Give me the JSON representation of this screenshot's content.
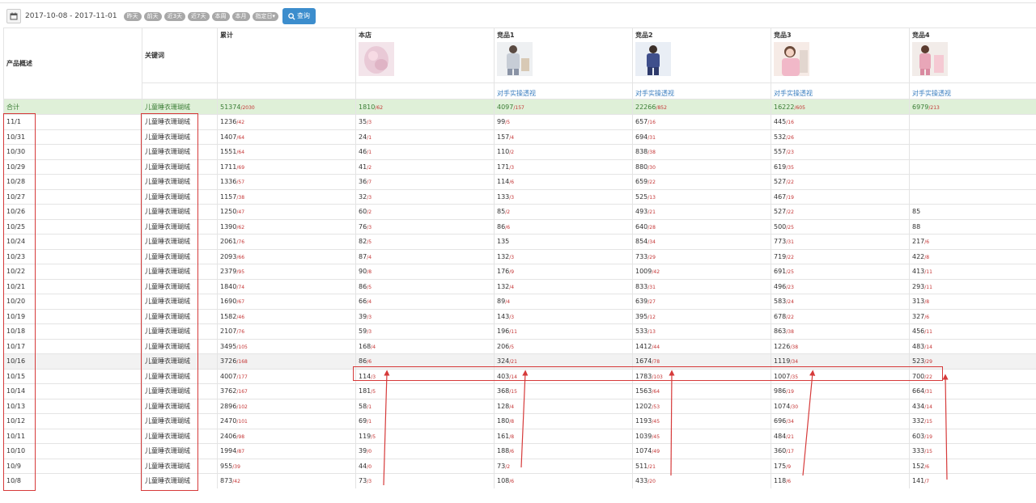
{
  "toolbar": {
    "date_range": "2017-10-08 - 2017-11-01",
    "quick_buttons": [
      "昨天",
      "前天",
      "近3天",
      "近7天",
      "本周",
      "本月",
      "指定日▾"
    ],
    "query_label": "查询"
  },
  "table": {
    "headers": {
      "overview": "产品概述",
      "keyword": "关键词",
      "cumulative": "累计",
      "store": "本店",
      "competitors": [
        "竞品1",
        "竞品2",
        "竞品3",
        "竞品4"
      ]
    },
    "competitor_link": "对手实操透视",
    "total": {
      "label": "合计",
      "keyword": "儿童睡衣珊瑚绒",
      "cells": [
        [
          "51374",
          "/2030"
        ],
        [
          "1810",
          "/62"
        ],
        [
          "4097",
          "/157"
        ],
        [
          "22266",
          "/852"
        ],
        [
          "16222",
          "/605"
        ],
        [
          "6979",
          "/213"
        ]
      ]
    },
    "rows": [
      {
        "date": "11/1",
        "keyword": "儿童睡衣珊瑚绒",
        "cells": [
          [
            "1236",
            "/42"
          ],
          [
            "35",
            "/3"
          ],
          [
            "99",
            "/5"
          ],
          [
            "657",
            "/16"
          ],
          [
            "445",
            "/16"
          ],
          [
            "",
            ""
          ]
        ]
      },
      {
        "date": "10/31",
        "keyword": "儿童睡衣珊瑚绒",
        "cells": [
          [
            "1407",
            "/64"
          ],
          [
            "24",
            "/1"
          ],
          [
            "157",
            "/4"
          ],
          [
            "694",
            "/31"
          ],
          [
            "532",
            "/26"
          ],
          [
            "",
            ""
          ]
        ]
      },
      {
        "date": "10/30",
        "keyword": "儿童睡衣珊瑚绒",
        "cells": [
          [
            "1551",
            "/64"
          ],
          [
            "46",
            "/1"
          ],
          [
            "110",
            "/2"
          ],
          [
            "838",
            "/38"
          ],
          [
            "557",
            "/23"
          ],
          [
            "",
            ""
          ]
        ]
      },
      {
        "date": "10/29",
        "keyword": "儿童睡衣珊瑚绒",
        "cells": [
          [
            "1711",
            "/69"
          ],
          [
            "41",
            "/2"
          ],
          [
            "171",
            "/3"
          ],
          [
            "880",
            "/30"
          ],
          [
            "619",
            "/35"
          ],
          [
            "",
            ""
          ]
        ]
      },
      {
        "date": "10/28",
        "keyword": "儿童睡衣珊瑚绒",
        "cells": [
          [
            "1336",
            "/57"
          ],
          [
            "36",
            "/7"
          ],
          [
            "114",
            "/6"
          ],
          [
            "659",
            "/22"
          ],
          [
            "527",
            "/22"
          ],
          [
            "",
            ""
          ]
        ]
      },
      {
        "date": "10/27",
        "keyword": "儿童睡衣珊瑚绒",
        "cells": [
          [
            "1157",
            "/38"
          ],
          [
            "32",
            "/3"
          ],
          [
            "133",
            "/3"
          ],
          [
            "525",
            "/13"
          ],
          [
            "467",
            "/19"
          ],
          [
            "",
            ""
          ]
        ]
      },
      {
        "date": "10/26",
        "keyword": "儿童睡衣珊瑚绒",
        "cells": [
          [
            "1250",
            "/47"
          ],
          [
            "60",
            "/2"
          ],
          [
            "85",
            "/2"
          ],
          [
            "493",
            "/21"
          ],
          [
            "527",
            "/22"
          ],
          [
            "85",
            ""
          ]
        ]
      },
      {
        "date": "10/25",
        "keyword": "儿童睡衣珊瑚绒",
        "cells": [
          [
            "1390",
            "/62"
          ],
          [
            "76",
            "/3"
          ],
          [
            "86",
            "/6"
          ],
          [
            "640",
            "/28"
          ],
          [
            "500",
            "/25"
          ],
          [
            "88",
            ""
          ]
        ]
      },
      {
        "date": "10/24",
        "keyword": "儿童睡衣珊瑚绒",
        "cells": [
          [
            "2061",
            "/76"
          ],
          [
            "82",
            "/5"
          ],
          [
            "135",
            ""
          ],
          [
            "854",
            "/34"
          ],
          [
            "773",
            "/31"
          ],
          [
            "217",
            "/6"
          ]
        ]
      },
      {
        "date": "10/23",
        "keyword": "儿童睡衣珊瑚绒",
        "cells": [
          [
            "2093",
            "/66"
          ],
          [
            "87",
            "/4"
          ],
          [
            "132",
            "/3"
          ],
          [
            "733",
            "/29"
          ],
          [
            "719",
            "/22"
          ],
          [
            "422",
            "/8"
          ]
        ]
      },
      {
        "date": "10/22",
        "keyword": "儿童睡衣珊瑚绒",
        "cells": [
          [
            "2379",
            "/95"
          ],
          [
            "90",
            "/8"
          ],
          [
            "176",
            "/9"
          ],
          [
            "1009",
            "/42"
          ],
          [
            "691",
            "/25"
          ],
          [
            "413",
            "/11"
          ]
        ]
      },
      {
        "date": "10/21",
        "keyword": "儿童睡衣珊瑚绒",
        "cells": [
          [
            "1840",
            "/74"
          ],
          [
            "86",
            "/5"
          ],
          [
            "132",
            "/4"
          ],
          [
            "833",
            "/31"
          ],
          [
            "496",
            "/23"
          ],
          [
            "293",
            "/11"
          ]
        ]
      },
      {
        "date": "10/20",
        "keyword": "儿童睡衣珊瑚绒",
        "cells": [
          [
            "1690",
            "/67"
          ],
          [
            "66",
            "/4"
          ],
          [
            "89",
            "/4"
          ],
          [
            "639",
            "/27"
          ],
          [
            "583",
            "/24"
          ],
          [
            "313",
            "/8"
          ]
        ]
      },
      {
        "date": "10/19",
        "keyword": "儿童睡衣珊瑚绒",
        "cells": [
          [
            "1582",
            "/46"
          ],
          [
            "39",
            "/3"
          ],
          [
            "143",
            "/3"
          ],
          [
            "395",
            "/12"
          ],
          [
            "678",
            "/22"
          ],
          [
            "327",
            "/6"
          ]
        ]
      },
      {
        "date": "10/18",
        "keyword": "儿童睡衣珊瑚绒",
        "cells": [
          [
            "2107",
            "/76"
          ],
          [
            "59",
            "/3"
          ],
          [
            "196",
            "/11"
          ],
          [
            "533",
            "/13"
          ],
          [
            "863",
            "/38"
          ],
          [
            "456",
            "/11"
          ]
        ]
      },
      {
        "date": "10/17",
        "keyword": "儿童睡衣珊瑚绒",
        "cells": [
          [
            "3495",
            "/105"
          ],
          [
            "168",
            "/4"
          ],
          [
            "206",
            "/5"
          ],
          [
            "1412",
            "/44"
          ],
          [
            "1226",
            "/38"
          ],
          [
            "483",
            "/14"
          ]
        ]
      },
      {
        "date": "10/16",
        "keyword": "儿童睡衣珊瑚绒",
        "cells": [
          [
            "3726",
            "/168"
          ],
          [
            "86",
            "/6"
          ],
          [
            "324",
            "/21"
          ],
          [
            "1674",
            "/78"
          ],
          [
            "1119",
            "/34"
          ],
          [
            "523",
            "/29"
          ]
        ]
      },
      {
        "date": "10/15",
        "keyword": "儿童睡衣珊瑚绒",
        "cells": [
          [
            "4007",
            "/177"
          ],
          [
            "114",
            "/3"
          ],
          [
            "403",
            "/14"
          ],
          [
            "1783",
            "/103"
          ],
          [
            "1007",
            "/35"
          ],
          [
            "700",
            "/22"
          ]
        ]
      },
      {
        "date": "10/14",
        "keyword": "儿童睡衣珊瑚绒",
        "cells": [
          [
            "3762",
            "/167"
          ],
          [
            "181",
            "/5"
          ],
          [
            "368",
            "/15"
          ],
          [
            "1563",
            "/64"
          ],
          [
            "986",
            "/19"
          ],
          [
            "664",
            "/31"
          ]
        ]
      },
      {
        "date": "10/13",
        "keyword": "儿童睡衣珊瑚绒",
        "cells": [
          [
            "2896",
            "/102"
          ],
          [
            "58",
            "/1"
          ],
          [
            "128",
            "/4"
          ],
          [
            "1202",
            "/53"
          ],
          [
            "1074",
            "/30"
          ],
          [
            "434",
            "/14"
          ]
        ]
      },
      {
        "date": "10/12",
        "keyword": "儿童睡衣珊瑚绒",
        "cells": [
          [
            "2470",
            "/101"
          ],
          [
            "69",
            "/1"
          ],
          [
            "180",
            "/8"
          ],
          [
            "1193",
            "/45"
          ],
          [
            "696",
            "/34"
          ],
          [
            "332",
            "/15"
          ]
        ]
      },
      {
        "date": "10/11",
        "keyword": "儿童睡衣珊瑚绒",
        "cells": [
          [
            "2406",
            "/98"
          ],
          [
            "119",
            "/5"
          ],
          [
            "161",
            "/8"
          ],
          [
            "1039",
            "/45"
          ],
          [
            "484",
            "/21"
          ],
          [
            "603",
            "/19"
          ]
        ]
      },
      {
        "date": "10/10",
        "keyword": "儿童睡衣珊瑚绒",
        "cells": [
          [
            "1994",
            "/87"
          ],
          [
            "39",
            "/0"
          ],
          [
            "188",
            "/6"
          ],
          [
            "1074",
            "/49"
          ],
          [
            "360",
            "/17"
          ],
          [
            "333",
            "/15"
          ]
        ]
      },
      {
        "date": "10/9",
        "keyword": "儿童睡衣珊瑚绒",
        "cells": [
          [
            "955",
            "/39"
          ],
          [
            "44",
            "/0"
          ],
          [
            "73",
            "/2"
          ],
          [
            "511",
            "/21"
          ],
          [
            "175",
            "/9"
          ],
          [
            "152",
            "/6"
          ]
        ]
      },
      {
        "date": "10/8",
        "keyword": "儿童睡衣珊瑚绒",
        "cells": [
          [
            "873",
            "/42"
          ],
          [
            "73",
            "/3"
          ],
          [
            "108",
            "/6"
          ],
          [
            "433",
            "/20"
          ],
          [
            "118",
            "/6"
          ],
          [
            "141",
            "/7"
          ]
        ]
      }
    ]
  },
  "colors": {
    "accent": "#3c8dcd",
    "total_row_bg": "#dff0d8",
    "annotation": "#d63a3a",
    "subvalue": "#c43333"
  }
}
